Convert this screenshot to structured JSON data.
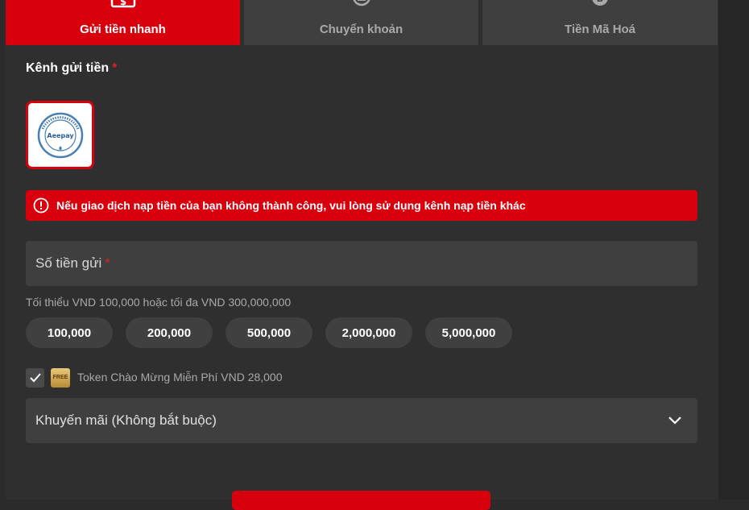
{
  "tabs": [
    {
      "label": "Gửi tiền nhanh",
      "icon": "fast-deposit-icon",
      "active": true
    },
    {
      "label": "Chuyển khoản",
      "icon": "bank-transfer-icon",
      "active": false
    },
    {
      "label": "Tiền Mã Hoá",
      "icon": "crypto-coin-icon",
      "active": false
    }
  ],
  "channel_section": {
    "label": "Kênh gửi tiền",
    "required_mark": "*",
    "selected_channel": "Aeepay"
  },
  "alert": {
    "icon": "alert-circle-icon",
    "text": "Nếu giao dịch nạp tiền của bạn không thành công, vui lòng sử dụng kênh nạp tiền khác"
  },
  "amount": {
    "placeholder": "Số tiền gửi",
    "required_mark": "*",
    "hint": "Tối thiểu VND 100,000 hoặc tối đa VND 300,000,000",
    "quick_amounts": [
      "100,000",
      "200,000",
      "500,000",
      "2,000,000",
      "5,000,000"
    ]
  },
  "token": {
    "checked": true,
    "icon_text": "FREE",
    "label": "Token Chào Mừng Miễn Phí VND 28,000"
  },
  "promotion": {
    "placeholder": "Khuyến mãi (Không bắt buộc)",
    "icon": "chevron-down-icon"
  },
  "colors": {
    "accent": "#d8000d",
    "background": "#2f2f2f",
    "field": "#3f3f3f",
    "muted_text": "#a9a9a9"
  }
}
